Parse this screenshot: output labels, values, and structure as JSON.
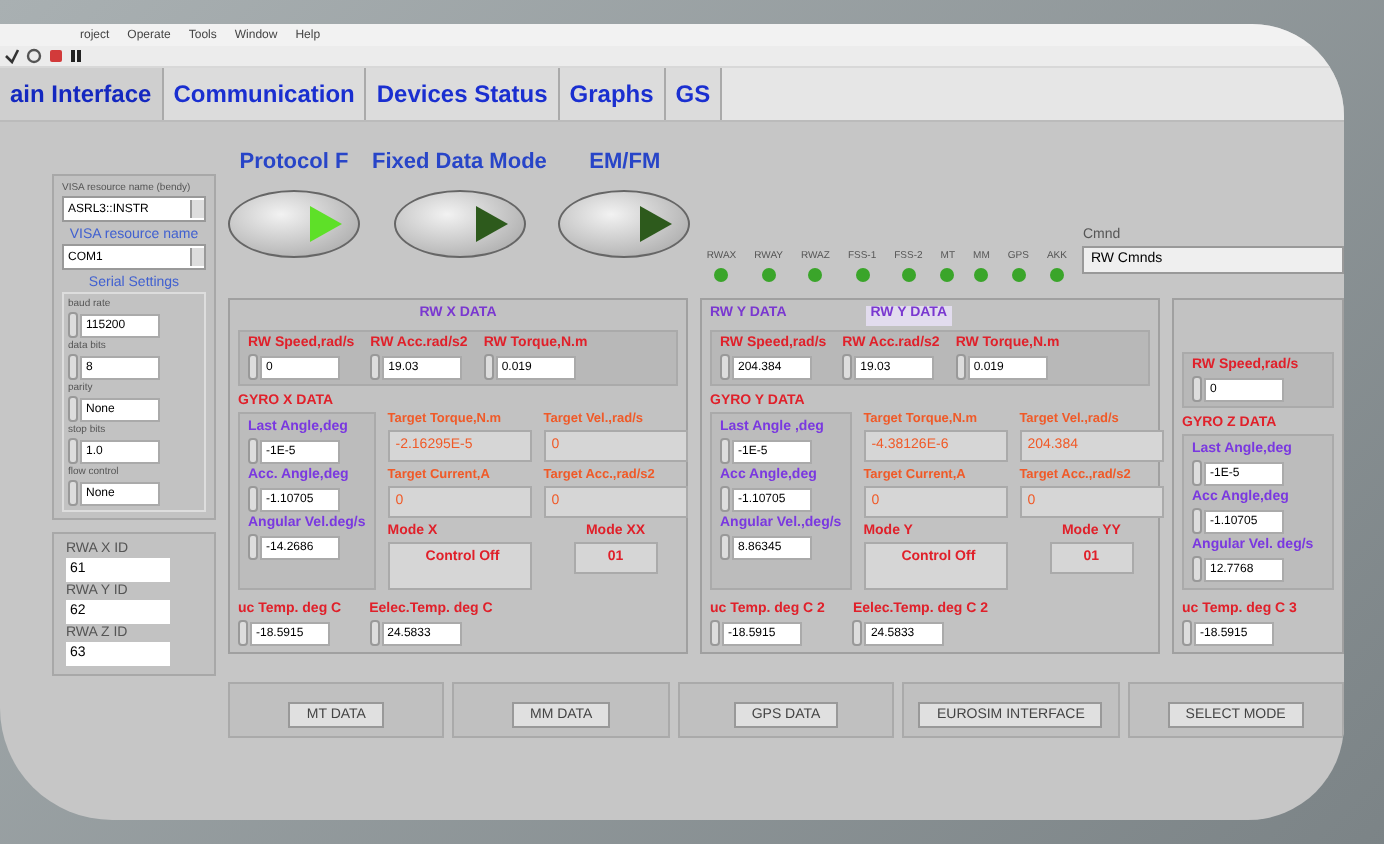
{
  "window": {
    "menu": [
      "roject",
      "Operate",
      "Tools",
      "Window",
      "Help"
    ]
  },
  "tabs": [
    {
      "label": "ain Interface",
      "selected": true
    },
    {
      "label": "Communication",
      "selected": false
    },
    {
      "label": "Devices Status",
      "selected": false
    },
    {
      "label": "Graphs",
      "selected": false
    },
    {
      "label": "GS",
      "selected": false
    }
  ],
  "mode_switches": [
    {
      "label": "Protocol F",
      "on": true
    },
    {
      "label": "Fixed Data Mode",
      "on": false
    },
    {
      "label": "EM/FM",
      "on": false
    }
  ],
  "indicators": [
    {
      "label": "RWAX",
      "on": true
    },
    {
      "label": "RWAY",
      "on": true
    },
    {
      "label": "RWAZ",
      "on": true
    },
    {
      "label": "FSS-1",
      "on": true
    },
    {
      "label": "FSS-2",
      "on": true
    },
    {
      "label": "MT",
      "on": true
    },
    {
      "label": "MM",
      "on": true
    },
    {
      "label": "GPS",
      "on": true
    },
    {
      "label": "AKK",
      "on": true
    }
  ],
  "command": {
    "label": "Cmnd",
    "value": "RW Cmnds"
  },
  "visa": {
    "caption": "VISA resource name (bendy)",
    "value": "ASRL3::INSTR",
    "label": "VISA resource name",
    "port": "COM1"
  },
  "serial_settings": {
    "title": "Serial Settings",
    "fields": [
      {
        "label": "baud rate",
        "value": "115200"
      },
      {
        "label": "data bits",
        "value": "8"
      },
      {
        "label": "parity",
        "value": "None"
      },
      {
        "label": "stop bits",
        "value": "1.0"
      },
      {
        "label": "flow control",
        "value": "None"
      }
    ]
  },
  "ids": [
    {
      "label": "RWA X ID",
      "value": "61"
    },
    {
      "label": "RWA Y ID",
      "value": "62"
    },
    {
      "label": "RWA Z ID",
      "value": "63"
    }
  ],
  "axes": [
    {
      "title": "RW X DATA",
      "rw": [
        {
          "label": "RW Speed,rad/s",
          "value": "0"
        },
        {
          "label": "RW Acc.rad/s2",
          "value": "19.03"
        },
        {
          "label": "RW Torque,N.m",
          "value": "0.019"
        }
      ],
      "gyro_title": "GYRO X DATA",
      "gyro": [
        {
          "label": "Last Angle,deg",
          "value": "-1E-5"
        },
        {
          "label": "Acc. Angle,deg",
          "value": "-1.10705"
        },
        {
          "label": "Angular Vel.deg/s",
          "value": "-14.2686"
        }
      ],
      "targets": [
        {
          "label": "Target  Torque,N.m",
          "value": "-2.16295E-5"
        },
        {
          "label": "Target  Vel.,rad/s",
          "value": "0"
        },
        {
          "label": "Target  Current,A",
          "value": "0"
        },
        {
          "label": "Target  Acc.,rad/s2",
          "value": "0"
        }
      ],
      "mode": {
        "label": "Mode X",
        "value": "Control Off"
      },
      "mode_code": {
        "label": "Mode XX",
        "value": "01"
      },
      "temps": [
        {
          "label": "uc Temp. deg C",
          "value": "-18.5915"
        },
        {
          "label": "Eelec.Temp. deg C",
          "value": "24.5833"
        }
      ]
    },
    {
      "title": "RW Y DATA",
      "title2": "RW Y DATA",
      "rw": [
        {
          "label": "RW Speed,rad/s",
          "value": "204.384"
        },
        {
          "label": "RW Acc.rad/s2",
          "value": "19.03"
        },
        {
          "label": "RW Torque,N.m",
          "value": "0.019"
        }
      ],
      "gyro_title": "GYRO Y DATA",
      "gyro": [
        {
          "label": "Last Angle ,deg",
          "value": "-1E-5"
        },
        {
          "label": "Acc Angle,deg",
          "value": "-1.10705"
        },
        {
          "label": "Angular Vel.,deg/s",
          "value": "8.86345"
        }
      ],
      "targets": [
        {
          "label": "Target  Torque,N.m",
          "value": "-4.38126E-6"
        },
        {
          "label": "Target  Vel.,rad/s",
          "value": "204.384"
        },
        {
          "label": "Target  Current,A",
          "value": "0"
        },
        {
          "label": "Target  Acc.,rad/s2",
          "value": "0"
        }
      ],
      "mode": {
        "label": "Mode Y",
        "value": "Control Off"
      },
      "mode_code": {
        "label": "Mode  YY",
        "value": "01"
      },
      "temps": [
        {
          "label": "uc Temp. deg C 2",
          "value": "-18.5915"
        },
        {
          "label": "Eelec.Temp. deg C 2",
          "value": "24.5833"
        }
      ]
    },
    {
      "rw": [
        {
          "label": "RW Speed,rad/s",
          "value": "0"
        }
      ],
      "gyro_title": "GYRO Z DATA",
      "gyro": [
        {
          "label": "Last Angle,deg",
          "value": "-1E-5"
        },
        {
          "label": "Acc Angle,deg",
          "value": "-1.10705"
        },
        {
          "label": "Angular Vel. deg/s",
          "value": "12.7768"
        }
      ],
      "temps": [
        {
          "label": "uc Temp. deg C 3",
          "value": "-18.5915"
        }
      ]
    }
  ],
  "bottom_buttons": [
    "MT DATA",
    "MM DATA",
    "GPS DATA",
    "EUROSIM INTERFACE",
    "SELECT MODE"
  ]
}
